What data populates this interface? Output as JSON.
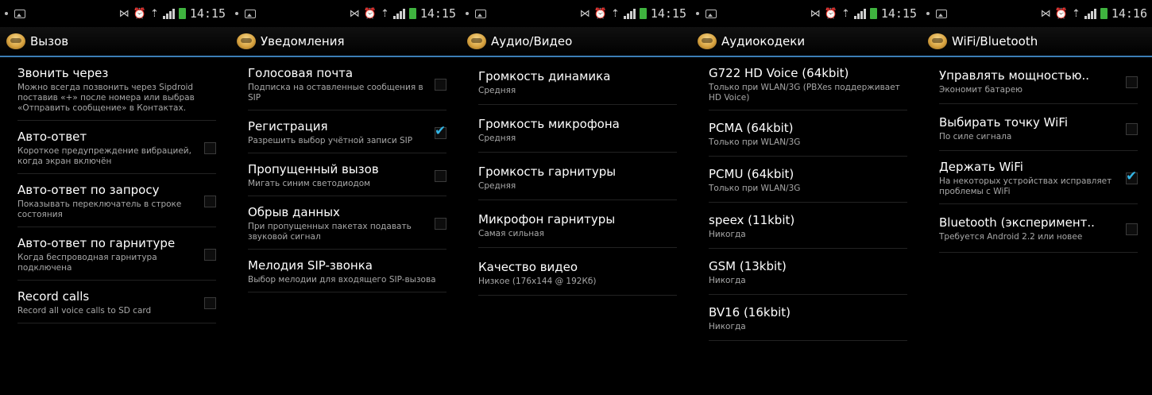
{
  "statusbar": {
    "icons": [
      "notification-dot-icon",
      "image-icon",
      "vibrate-icon",
      "alarm-icon",
      "wifi-icon",
      "signal-icon",
      "battery-icon"
    ]
  },
  "screens": [
    {
      "time": "14:15",
      "title": "Вызов",
      "items": [
        {
          "title": "Звонить через",
          "summary": "Можно всегда позвонить через Sipdroid поставив «+» после номера или выбрав «Отправить сообщение» в Контактах.",
          "checkbox": null
        },
        {
          "title": "Авто-ответ",
          "summary": "Короткое предупреждение вибрацией, когда экран включён",
          "checkbox": false
        },
        {
          "title": "Авто-ответ по запросу",
          "summary": "Показывать переключатель в строке состояния",
          "checkbox": false
        },
        {
          "title": "Авто-ответ по гарнитуре",
          "summary": "Когда беспроводная гарнитура подключена",
          "checkbox": false
        },
        {
          "title": "Record calls",
          "summary": "Record all voice calls to SD card",
          "checkbox": false
        }
      ]
    },
    {
      "time": "14:15",
      "title": "Уведомления",
      "items": [
        {
          "title": "Голосовая почта",
          "summary": "Подписка на оставленные сообщения в SIP",
          "checkbox": false
        },
        {
          "title": "Регистрация",
          "summary": "Разрешить выбор учётной записи SIP",
          "checkbox": true
        },
        {
          "title": "Пропущенный вызов",
          "summary": "Мигать синим светодиодом",
          "checkbox": false
        },
        {
          "title": "Обрыв данных",
          "summary": "При пропущенных пакетах подавать звуковой сигнал",
          "checkbox": false
        },
        {
          "title": "Мелодия SIP-звонка",
          "summary": "Выбор мелодии для входящего SIP-вызова",
          "checkbox": null
        }
      ]
    },
    {
      "time": "14:15",
      "title": "Аудио/Видео",
      "items": [
        {
          "title": "Громкость динамика",
          "summary": "Средняя",
          "checkbox": null
        },
        {
          "title": "Громкость микрофона",
          "summary": "Средняя",
          "checkbox": null
        },
        {
          "title": "Громкость гарнитуры",
          "summary": "Средняя",
          "checkbox": null
        },
        {
          "title": "Микрофон гарнитуры",
          "summary": "Самая сильная",
          "checkbox": null
        },
        {
          "title": "Качество видео",
          "summary": "Низкое (176x144 @ 192Кб)",
          "checkbox": null
        }
      ]
    },
    {
      "time": "14:15",
      "title": "Аудиокодеки",
      "items": [
        {
          "title": "G722 HD Voice (64kbit)",
          "summary": "Только при WLAN/3G (PBXes поддерживает HD Voice)",
          "checkbox": null
        },
        {
          "title": "PCMA (64kbit)",
          "summary": "Только при WLAN/3G",
          "checkbox": null
        },
        {
          "title": "PCMU (64kbit)",
          "summary": "Только при WLAN/3G",
          "checkbox": null
        },
        {
          "title": "speex (11kbit)",
          "summary": "Никогда",
          "checkbox": null
        },
        {
          "title": "GSM (13kbit)",
          "summary": "Никогда",
          "checkbox": null
        },
        {
          "title": "BV16 (16kbit)",
          "summary": "Никогда",
          "checkbox": null
        }
      ]
    },
    {
      "time": "14:16",
      "title": "WiFi/Bluetooth",
      "items": [
        {
          "title": "Управлять мощностью..",
          "summary": "Экономит батарею",
          "checkbox": false
        },
        {
          "title": "Выбирать точку WiFi",
          "summary": "По силе сигнала",
          "checkbox": false
        },
        {
          "title": "Держать WiFi",
          "summary": "На некоторых устройствах исправляет проблемы с WiFi",
          "checkbox": true
        },
        {
          "title": "Bluetooth (эксперимент..",
          "summary": "Требуется Android 2.2 или новее",
          "checkbox": false
        }
      ]
    }
  ]
}
